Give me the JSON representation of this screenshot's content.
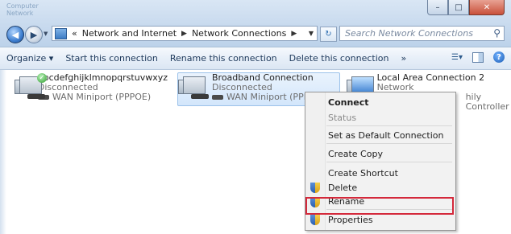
{
  "window": {
    "ghost_title_line1": "Computer",
    "ghost_title_line2": "Network",
    "controls": {
      "minimize": "–",
      "maximize": "□",
      "close": "✕"
    }
  },
  "navigation": {
    "address": {
      "overflow": "«",
      "crumbs": [
        "Network and Internet",
        "Network Connections"
      ]
    },
    "search_placeholder": "Search Network Connections",
    "icons": [
      "back-icon",
      "forward-icon",
      "refresh-icon",
      "search-icon"
    ]
  },
  "toolbar": {
    "organize": "Organize ▾",
    "start": "Start this connection",
    "rename": "Rename this connection",
    "delete": "Delete this connection",
    "more": "»"
  },
  "connections": [
    {
      "name": "abcdefghijklmnopqrstuvwxyz",
      "status": "Disconnected",
      "device": "WAN Miniport (PPPOE)"
    },
    {
      "name": "Broadband Connection",
      "status": "Disconnected",
      "device": "WAN Miniport (PPPOE)",
      "selected": true
    },
    {
      "name": "Local Area Connection 2",
      "status": "Network",
      "device": "hily Controller"
    }
  ],
  "context_menu": {
    "items": [
      "Connect",
      "Status",
      "Set as Default Connection",
      "Create Copy",
      "Create Shortcut",
      "Delete",
      "Rename",
      "Properties"
    ]
  },
  "colors": {
    "highlight_box": "#d4293b",
    "selection": "#d3e6fb"
  }
}
